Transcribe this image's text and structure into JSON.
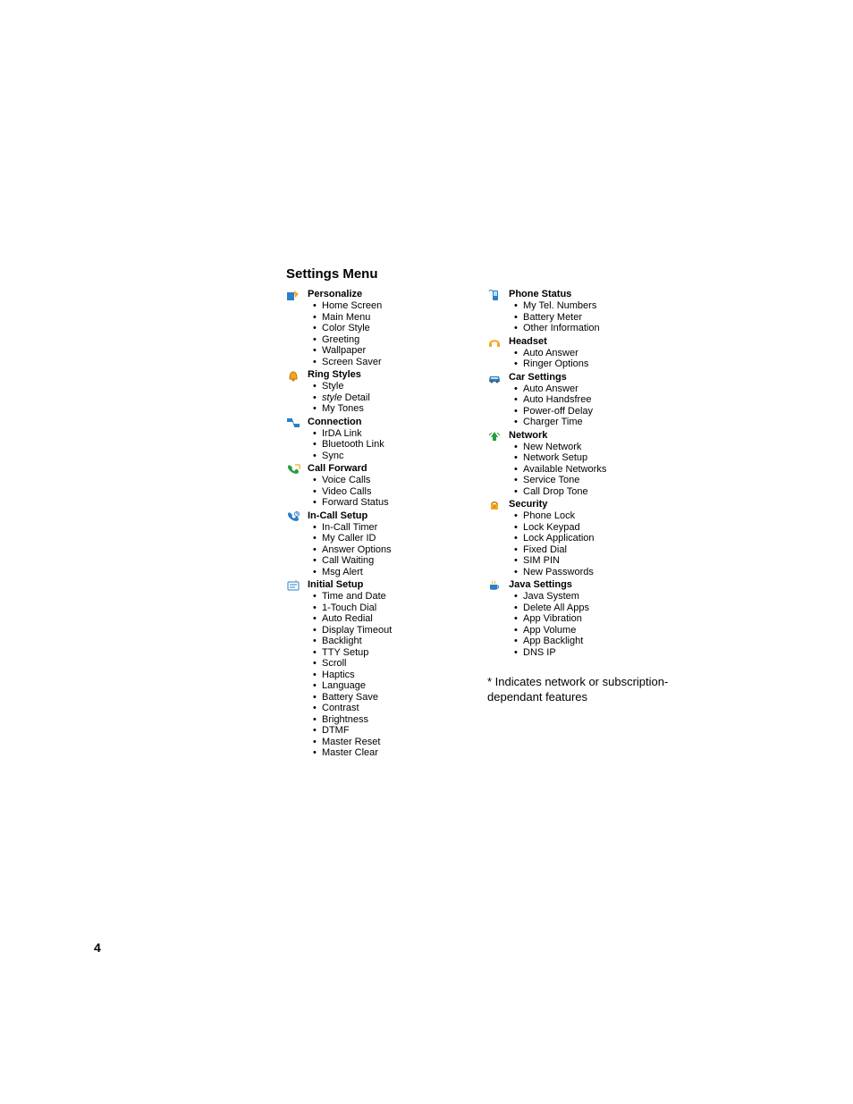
{
  "title": "Settings Menu",
  "left_column": [
    {
      "icon": "personalize-icon",
      "heading": "Personalize",
      "items": [
        "Home Screen",
        "Main Menu",
        "Color Style",
        "Greeting",
        "Wallpaper",
        "Screen Saver"
      ]
    },
    {
      "icon": "ring-styles-icon",
      "heading": "Ring Styles",
      "items_special": [
        {
          "text": "Style",
          "italic": false
        },
        {
          "prefix": "style",
          "suffix": " Detail",
          "italic_prefix": true
        },
        {
          "text": "My Tones",
          "italic": false
        }
      ]
    },
    {
      "icon": "connection-icon",
      "heading": "Connection",
      "items": [
        "IrDA Link",
        "Bluetooth Link",
        "Sync"
      ]
    },
    {
      "icon": "call-forward-icon",
      "heading": "Call Forward",
      "items": [
        "Voice Calls",
        "Video Calls",
        "Forward Status"
      ]
    },
    {
      "icon": "in-call-setup-icon",
      "heading": "In-Call Setup",
      "items": [
        "In-Call Timer",
        "My Caller ID",
        "Answer Options",
        "Call Waiting",
        "Msg Alert"
      ]
    },
    {
      "icon": "initial-setup-icon",
      "heading": "Initial Setup",
      "items": [
        "Time and Date",
        "1-Touch Dial",
        "Auto Redial",
        "Display Timeout",
        "Backlight",
        "TTY Setup",
        "Scroll",
        "Haptics",
        "Language",
        "Battery Save",
        "Contrast",
        "Brightness",
        "DTMF",
        "Master Reset",
        "Master Clear"
      ]
    }
  ],
  "right_column": [
    {
      "icon": "phone-status-icon",
      "heading": "Phone Status",
      "items": [
        "My Tel. Numbers",
        "Battery Meter",
        "Other Information"
      ]
    },
    {
      "icon": "headset-icon",
      "heading": "Headset",
      "items": [
        "Auto Answer",
        "Ringer Options"
      ]
    },
    {
      "icon": "car-settings-icon",
      "heading": "Car Settings",
      "items": [
        "Auto Answer",
        "Auto Handsfree",
        "Power-off Delay",
        "Charger Time"
      ]
    },
    {
      "icon": "network-icon",
      "heading": "Network",
      "items": [
        "New Network",
        "Network Setup",
        "Available Networks",
        "Service Tone",
        "Call Drop Tone"
      ]
    },
    {
      "icon": "security-icon",
      "heading": "Security",
      "items": [
        "Phone Lock",
        "Lock Keypad",
        "Lock Application",
        "Fixed Dial",
        "SIM PIN",
        "New Passwords"
      ]
    },
    {
      "icon": "java-settings-icon",
      "heading": "Java Settings",
      "items": [
        "Java System",
        "Delete All Apps",
        "App Vibration",
        "App Volume",
        "App Backlight",
        "DNS IP"
      ]
    }
  ],
  "footnote": "* Indicates network or subscription-dependant features",
  "page_number": "4"
}
